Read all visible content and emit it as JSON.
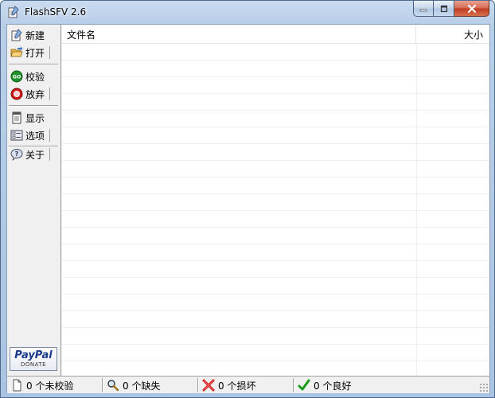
{
  "window": {
    "title": "FlashSFV 2.6"
  },
  "toolbar": {
    "new_label": "新建",
    "open_label": "打开",
    "verify_label": "校验",
    "abort_label": "放弃",
    "display_label": "显示",
    "options_label": "选项",
    "about_label": "关于"
  },
  "donate": {
    "logo": "PayPal",
    "caption": "DONATE"
  },
  "list": {
    "columns": {
      "name": "文件名",
      "size": "大小"
    },
    "rows": []
  },
  "status": {
    "unverified": "0 个未校验",
    "missing": "0 个缺失",
    "damaged": "0 个损坏",
    "good": "0 个良好"
  },
  "colors": {
    "frame": "#b9cfe8",
    "close_button": "#c0391e",
    "go_icon": "#1f8f2a",
    "stop_icon": "#d01818",
    "check_icon": "#1a9a1a",
    "cross_icon": "#cc1111"
  }
}
